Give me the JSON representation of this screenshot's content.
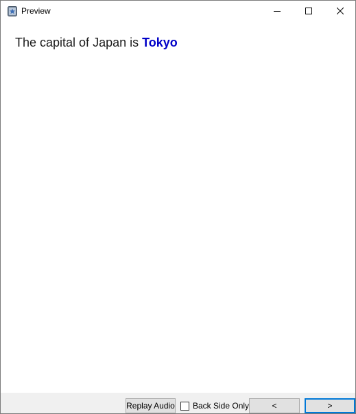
{
  "window": {
    "title": "Preview",
    "app_icon": "anki-star-icon",
    "controls": {
      "minimize_icon": "minimize-icon",
      "maximize_icon": "maximize-icon",
      "close_icon": "close-icon"
    }
  },
  "card": {
    "prefix": "The capital of Japan is ",
    "answer": "Tokyo",
    "answer_color": "#0000c8"
  },
  "bottombar": {
    "replay_label": "Replay Audio",
    "back_side_only_label": "Back Side Only",
    "back_side_only_checked": false,
    "prev_label": "<",
    "next_label": ">",
    "focus_color": "#0078d7"
  }
}
